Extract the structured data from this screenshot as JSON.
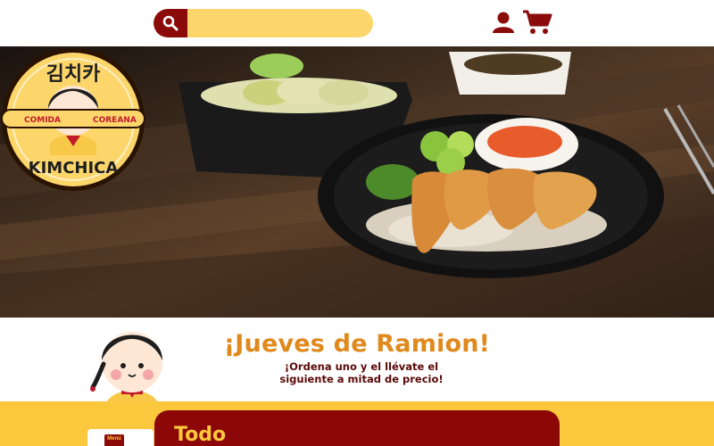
{
  "header": {
    "search": {
      "value": "",
      "placeholder": "",
      "icon": "search-icon"
    },
    "user_icon": "user-icon",
    "cart_icon": "cart-icon"
  },
  "hero": {
    "logo": {
      "korean_text": "김치카",
      "left_label": "COMIDA",
      "right_label": "COREANA",
      "brand": "KIMCHICA"
    }
  },
  "promo": {
    "title": "¡Jueves de Ramion!",
    "subtitle_line1": "¡Ordena uno y el llévate el",
    "subtitle_line2": "siguiente a mitad de precio!"
  },
  "menu": {
    "tag_label": "Menú",
    "category_title": "Todo"
  },
  "colors": {
    "brand_red": "#8b0b0b",
    "brand_yellow": "#fbc73d",
    "promo_orange": "#e0891c",
    "search_yellow": "#fdd66b"
  }
}
